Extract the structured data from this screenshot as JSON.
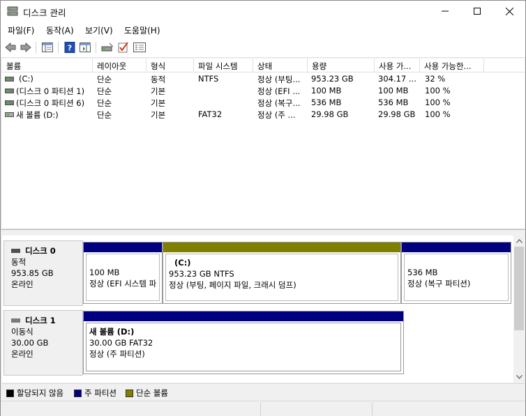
{
  "window": {
    "title": "디스크 관리"
  },
  "menu": [
    "파일(F)",
    "동작(A)",
    "보기(V)",
    "도움말(H)"
  ],
  "toolbar": {
    "buttons": [
      "back-icon",
      "forward-icon",
      "show-hide-console-tree-icon",
      "help-icon",
      "action-pane-icon",
      "connect-drive-icon",
      "check-icon",
      "properties-icon"
    ]
  },
  "volume_list": {
    "columns": [
      "볼륨",
      "레이아웃",
      "형식",
      "파일 시스템",
      "상태",
      "용량",
      "사용 가...",
      "사용 가능한..."
    ],
    "rows": [
      {
        "volume": "(C:)",
        "layout": "단순",
        "type": "동적",
        "fs": "NTFS",
        "status": "정상 (부팅...",
        "capacity": "953.23 GB",
        "free": "304.17 ...",
        "pct_free": "32 %"
      },
      {
        "volume": "(디스크 0 파티션 1)",
        "layout": "단순",
        "type": "기본",
        "fs": "",
        "status": "정상 (EFI ...",
        "capacity": "100 MB",
        "free": "100 MB",
        "pct_free": "100 %"
      },
      {
        "volume": "(디스크 0 파티션 6)",
        "layout": "단순",
        "type": "기본",
        "fs": "",
        "status": "정상 (복구...",
        "capacity": "536 MB",
        "free": "536 MB",
        "pct_free": "100 %"
      },
      {
        "volume": "새 볼륨 (D:)",
        "layout": "단순",
        "type": "기본",
        "fs": "FAT32",
        "status": "정상 (주 ...",
        "capacity": "29.98 GB",
        "free": "29.98 GB",
        "pct_free": "100 %"
      }
    ]
  },
  "disks": [
    {
      "name": "디스크 0",
      "type": "동적",
      "size": "953.85 GB",
      "state": "온라인",
      "partitions": [
        {
          "name": "",
          "size": "100 MB",
          "status": "정상 (EFI 시스템 파",
          "bar_color": "#000080"
        },
        {
          "name": "(C:)",
          "size": "953.23 GB NTFS",
          "status": "정상 (부팅, 페이지 파일, 크래시 덤프)",
          "bar_color": "#808000"
        },
        {
          "name": "",
          "size": "536 MB",
          "status": "정상 (복구 파티션)",
          "bar_color": "#000080"
        }
      ]
    },
    {
      "name": "디스크 1",
      "type": "이동식",
      "size": "30.00 GB",
      "state": "온라인",
      "partitions": [
        {
          "name": "새 볼륨  (D:)",
          "size": "30.00 GB FAT32",
          "status": "정상 (주 파티션)",
          "bar_color": "#000080"
        }
      ]
    }
  ],
  "legend": [
    {
      "label": "할당되지 않음",
      "color": "#000000"
    },
    {
      "label": "주 파티션",
      "color": "#000080"
    },
    {
      "label": "단순 볼륨",
      "color": "#808000"
    }
  ]
}
